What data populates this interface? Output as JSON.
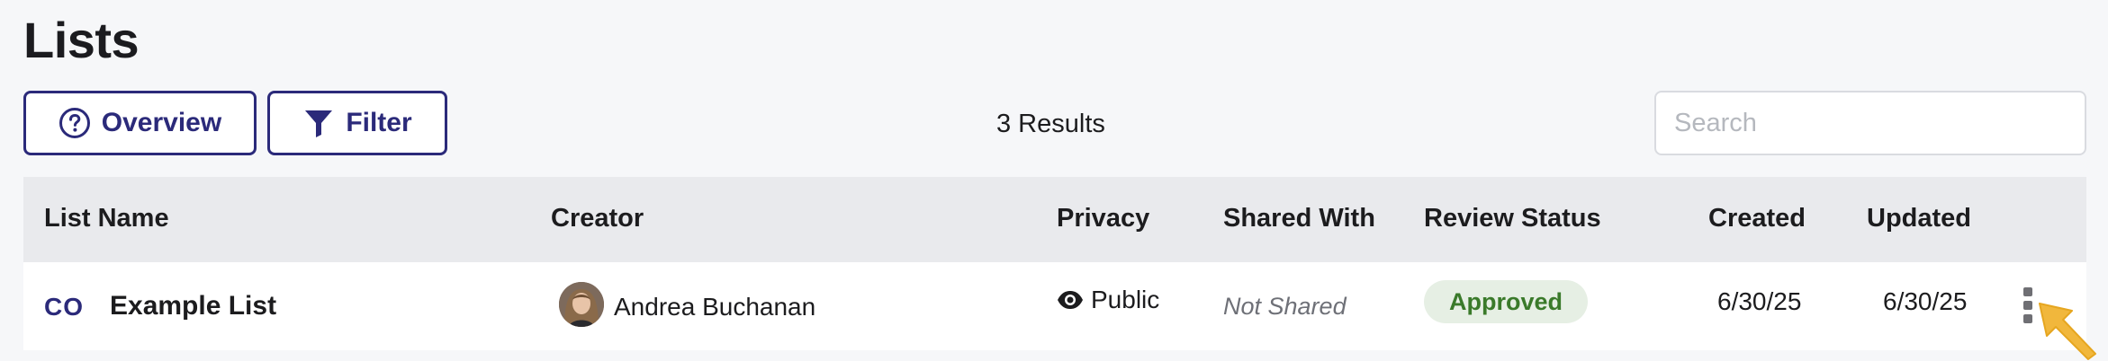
{
  "page": {
    "title": "Lists"
  },
  "toolbar": {
    "overview_label": "Overview",
    "filter_label": "Filter",
    "results_text": "3 Results",
    "search_placeholder": "Search"
  },
  "table": {
    "columns": [
      "List Name",
      "Creator",
      "Privacy",
      "Shared With",
      "Review Status",
      "Created",
      "Updated"
    ],
    "rows": [
      {
        "code": "CO",
        "name": "Example List",
        "creator": "Andrea Buchanan",
        "privacy": "Public",
        "shared_with": "Not Shared",
        "review_status": "Approved",
        "created": "6/30/25",
        "updated": "6/30/25"
      }
    ]
  },
  "icons": {
    "overview": "question-circle-icon",
    "filter": "funnel-icon",
    "privacy": "eye-icon",
    "row_menu": "kebab-menu-icon",
    "cursor": "arrow-cursor"
  },
  "colors": {
    "brand": "#2b2a7a",
    "approved_bg": "#e6efe4",
    "approved_text": "#3a7a2a",
    "cursor": "#f1b73c"
  }
}
